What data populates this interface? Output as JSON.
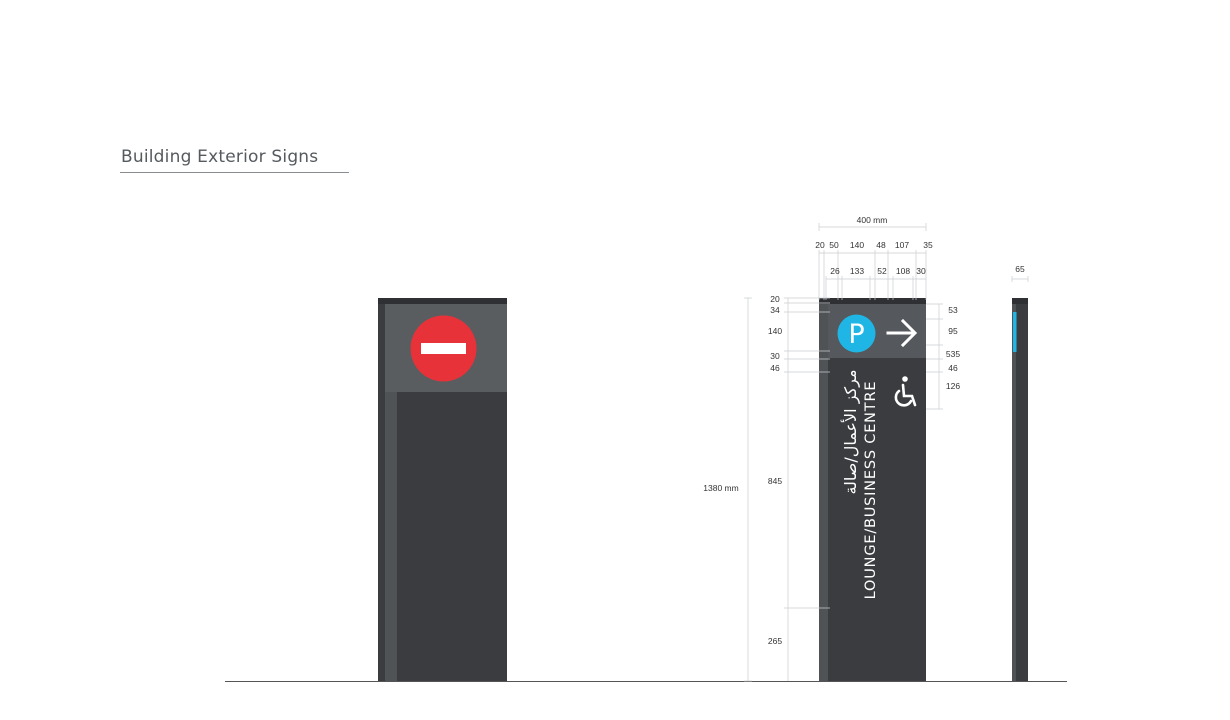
{
  "page": {
    "title": "Building Exterior Signs"
  },
  "colors": {
    "sign_body": "#3a3c3f",
    "sign_edge": "#55585b",
    "header_band": "#5a5d60",
    "no_entry_red": "#e8323a",
    "parking_blue": "#1fb6e6",
    "accent_blue": "#1fb6e6",
    "dim_line": "#c9cccf",
    "ground": "#555555"
  },
  "signs": {
    "no_entry": {
      "icon": "no-entry-icon"
    },
    "directional": {
      "parking_letter": "P",
      "arrow_icon": "arrow-right-icon",
      "accessible_icon": "wheelchair-icon",
      "label_en": "LOUNGE/BUSINESS CENTRE",
      "label_ar": "مركز الأعمال/صالة"
    },
    "side_view": {
      "accent": "blue-strip"
    }
  },
  "dimensions": {
    "width_total": "400 mm",
    "top_row": [
      "20",
      "50",
      "140",
      "48",
      "107",
      "35"
    ],
    "second_row": [
      "26",
      "133",
      "52",
      "108",
      "30"
    ],
    "left_col": [
      "20",
      "34",
      "140",
      "30",
      "46",
      "845",
      "265"
    ],
    "right_col": [
      "53",
      "95",
      "535",
      "46",
      "126"
    ],
    "height_total": "1380 mm",
    "side_depth": "65"
  }
}
